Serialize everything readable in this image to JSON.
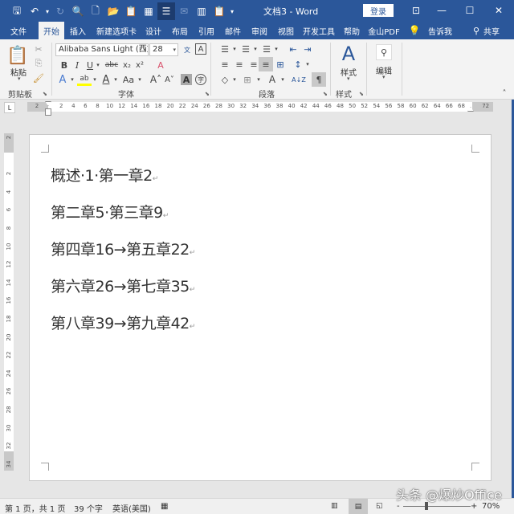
{
  "window": {
    "title": "文档3  -  Word",
    "login_label": "登录",
    "controls": {
      "ribbon_display": "⊡",
      "minimize": "—",
      "maximize": "☐",
      "close": "✕"
    }
  },
  "quick_access": [
    {
      "name": "save-icon",
      "glyph": "🖫"
    },
    {
      "name": "undo-icon",
      "glyph": "↶"
    },
    {
      "name": "undo-dropdown-icon",
      "glyph": "▾"
    },
    {
      "name": "redo-icon",
      "glyph": "↻"
    },
    {
      "name": "print-preview-icon",
      "glyph": "🔍"
    },
    {
      "name": "new-document-icon",
      "glyph": "🗋"
    },
    {
      "name": "open-folder-icon",
      "glyph": "📂"
    },
    {
      "name": "paste-special-icon",
      "glyph": "📋"
    },
    {
      "name": "screenshot-icon",
      "glyph": "▦"
    },
    {
      "name": "read-mode-icon",
      "glyph": "☰"
    },
    {
      "name": "email-icon",
      "glyph": "✉"
    },
    {
      "name": "columns-icon",
      "glyph": "▥"
    },
    {
      "name": "clipboard-icon",
      "glyph": "📋"
    },
    {
      "name": "qat-customize-icon",
      "glyph": "▾"
    }
  ],
  "tabs": [
    {
      "label": "文件",
      "active": false
    },
    {
      "label": "开始",
      "active": true
    },
    {
      "label": "插入",
      "active": false
    },
    {
      "label": "新建选项卡",
      "active": false
    },
    {
      "label": "设计",
      "active": false
    },
    {
      "label": "布局",
      "active": false
    },
    {
      "label": "引用",
      "active": false
    },
    {
      "label": "邮件",
      "active": false
    },
    {
      "label": "审阅",
      "active": false
    },
    {
      "label": "视图",
      "active": false
    },
    {
      "label": "开发工具",
      "active": false
    },
    {
      "label": "帮助",
      "active": false
    },
    {
      "label": "金山PDF",
      "active": false
    }
  ],
  "tell_me": {
    "icon": "lightbulb-icon",
    "label": "告诉我"
  },
  "share": {
    "icon": "person-add-icon",
    "label": "共享"
  },
  "ribbon": {
    "clipboard": {
      "label": "剪贴板",
      "paste_label": "粘贴",
      "cut_glyph": "✂",
      "copy_glyph": "⎘",
      "format_painter_glyph": "🖌"
    },
    "font": {
      "label": "字体",
      "font_name": "Alibaba Sans Light (西文",
      "font_size": "28",
      "phonetic_glyph": "文",
      "char_border_glyph": "A",
      "bold": "B",
      "italic": "I",
      "underline": "U",
      "strikethrough": "abc",
      "subscript": "x₂",
      "superscript": "x²",
      "clear_format_glyph": "A",
      "text_effects_glyph": "A",
      "highlight_glyph": "ab",
      "font_color_glyph": "A",
      "change_case": "Aa",
      "grow_font": "A˄",
      "shrink_font": "A˅",
      "char_shading_glyph": "A",
      "enclose_glyph": "字",
      "highlight_color": "#ffff00",
      "font_color": "#c00000"
    },
    "paragraph": {
      "label": "段落",
      "bullets": "☰",
      "numbering": "☰",
      "multilevel": "☰",
      "decrease_indent": "⇤",
      "increase_indent": "⇥",
      "align_left": "≡",
      "center": "≡",
      "align_right": "≡",
      "justify": "≡",
      "distributed": "⊞",
      "line_spacing": "↕",
      "shading": "◇",
      "borders": "⊞",
      "chinese_layout": "A",
      "sort": "A↓Z",
      "show_marks": "¶"
    },
    "styles": {
      "label": "样式",
      "button_label": "样式"
    },
    "editing": {
      "button_label": "编辑"
    },
    "collapse_glyph": "˄"
  },
  "ruler": {
    "horizontal_ticks": [
      "2",
      "",
      "2",
      "4",
      "6",
      "8",
      "10",
      "12",
      "14",
      "16",
      "18",
      "20",
      "22",
      "24",
      "26",
      "28",
      "30",
      "32",
      "34",
      "36",
      "38",
      "40",
      "42",
      "44",
      "46",
      "48",
      "50",
      "52",
      "54",
      "56",
      "58",
      "60",
      "62",
      "64",
      "66",
      "68",
      "",
      "72"
    ],
    "vertical_ticks": [
      "2",
      "",
      "2",
      "4",
      "6",
      "8",
      "10",
      "12",
      "14",
      "16",
      "18",
      "20",
      "22",
      "24",
      "26",
      "28",
      "30",
      "32",
      "34"
    ],
    "tab_selector_glyph": "L"
  },
  "document": {
    "lines": [
      {
        "text": "概述·1·第一章2",
        "mark": "↵"
      },
      {
        "text": "第二章5·第三章9",
        "mark": "↵"
      },
      {
        "text": "第四章16→第五章22",
        "mark": "↵"
      },
      {
        "text": "第六章26→第七章35",
        "mark": "↵"
      },
      {
        "text": "第八章39→第九章42",
        "mark": "↵"
      }
    ]
  },
  "status": {
    "page_info": "第 1 页，共 1 页",
    "word_count": "39 个字",
    "language": "英语(美国)",
    "macro_icon": "▦",
    "read_mode": "📖",
    "print_layout": "▤",
    "web_layout": "🌐",
    "zoom_minus": "-",
    "zoom_plus": "+",
    "zoom_level": "70%",
    "zoom_fraction": 0.35
  },
  "watermark": "头条 @爆炒Office"
}
